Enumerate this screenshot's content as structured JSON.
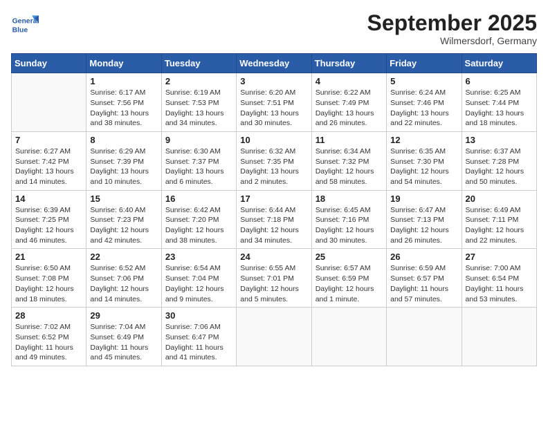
{
  "header": {
    "logo_text_general": "General",
    "logo_text_blue": "Blue",
    "month": "September 2025",
    "location": "Wilmersdorf, Germany"
  },
  "days_of_week": [
    "Sunday",
    "Monday",
    "Tuesday",
    "Wednesday",
    "Thursday",
    "Friday",
    "Saturday"
  ],
  "weeks": [
    [
      {
        "day": "",
        "sunrise": "",
        "sunset": "",
        "daylight": ""
      },
      {
        "day": "1",
        "sunrise": "Sunrise: 6:17 AM",
        "sunset": "Sunset: 7:56 PM",
        "daylight": "Daylight: 13 hours and 38 minutes."
      },
      {
        "day": "2",
        "sunrise": "Sunrise: 6:19 AM",
        "sunset": "Sunset: 7:53 PM",
        "daylight": "Daylight: 13 hours and 34 minutes."
      },
      {
        "day": "3",
        "sunrise": "Sunrise: 6:20 AM",
        "sunset": "Sunset: 7:51 PM",
        "daylight": "Daylight: 13 hours and 30 minutes."
      },
      {
        "day": "4",
        "sunrise": "Sunrise: 6:22 AM",
        "sunset": "Sunset: 7:49 PM",
        "daylight": "Daylight: 13 hours and 26 minutes."
      },
      {
        "day": "5",
        "sunrise": "Sunrise: 6:24 AM",
        "sunset": "Sunset: 7:46 PM",
        "daylight": "Daylight: 13 hours and 22 minutes."
      },
      {
        "day": "6",
        "sunrise": "Sunrise: 6:25 AM",
        "sunset": "Sunset: 7:44 PM",
        "daylight": "Daylight: 13 hours and 18 minutes."
      }
    ],
    [
      {
        "day": "7",
        "sunrise": "Sunrise: 6:27 AM",
        "sunset": "Sunset: 7:42 PM",
        "daylight": "Daylight: 13 hours and 14 minutes."
      },
      {
        "day": "8",
        "sunrise": "Sunrise: 6:29 AM",
        "sunset": "Sunset: 7:39 PM",
        "daylight": "Daylight: 13 hours and 10 minutes."
      },
      {
        "day": "9",
        "sunrise": "Sunrise: 6:30 AM",
        "sunset": "Sunset: 7:37 PM",
        "daylight": "Daylight: 13 hours and 6 minutes."
      },
      {
        "day": "10",
        "sunrise": "Sunrise: 6:32 AM",
        "sunset": "Sunset: 7:35 PM",
        "daylight": "Daylight: 13 hours and 2 minutes."
      },
      {
        "day": "11",
        "sunrise": "Sunrise: 6:34 AM",
        "sunset": "Sunset: 7:32 PM",
        "daylight": "Daylight: 12 hours and 58 minutes."
      },
      {
        "day": "12",
        "sunrise": "Sunrise: 6:35 AM",
        "sunset": "Sunset: 7:30 PM",
        "daylight": "Daylight: 12 hours and 54 minutes."
      },
      {
        "day": "13",
        "sunrise": "Sunrise: 6:37 AM",
        "sunset": "Sunset: 7:28 PM",
        "daylight": "Daylight: 12 hours and 50 minutes."
      }
    ],
    [
      {
        "day": "14",
        "sunrise": "Sunrise: 6:39 AM",
        "sunset": "Sunset: 7:25 PM",
        "daylight": "Daylight: 12 hours and 46 minutes."
      },
      {
        "day": "15",
        "sunrise": "Sunrise: 6:40 AM",
        "sunset": "Sunset: 7:23 PM",
        "daylight": "Daylight: 12 hours and 42 minutes."
      },
      {
        "day": "16",
        "sunrise": "Sunrise: 6:42 AM",
        "sunset": "Sunset: 7:20 PM",
        "daylight": "Daylight: 12 hours and 38 minutes."
      },
      {
        "day": "17",
        "sunrise": "Sunrise: 6:44 AM",
        "sunset": "Sunset: 7:18 PM",
        "daylight": "Daylight: 12 hours and 34 minutes."
      },
      {
        "day": "18",
        "sunrise": "Sunrise: 6:45 AM",
        "sunset": "Sunset: 7:16 PM",
        "daylight": "Daylight: 12 hours and 30 minutes."
      },
      {
        "day": "19",
        "sunrise": "Sunrise: 6:47 AM",
        "sunset": "Sunset: 7:13 PM",
        "daylight": "Daylight: 12 hours and 26 minutes."
      },
      {
        "day": "20",
        "sunrise": "Sunrise: 6:49 AM",
        "sunset": "Sunset: 7:11 PM",
        "daylight": "Daylight: 12 hours and 22 minutes."
      }
    ],
    [
      {
        "day": "21",
        "sunrise": "Sunrise: 6:50 AM",
        "sunset": "Sunset: 7:08 PM",
        "daylight": "Daylight: 12 hours and 18 minutes."
      },
      {
        "day": "22",
        "sunrise": "Sunrise: 6:52 AM",
        "sunset": "Sunset: 7:06 PM",
        "daylight": "Daylight: 12 hours and 14 minutes."
      },
      {
        "day": "23",
        "sunrise": "Sunrise: 6:54 AM",
        "sunset": "Sunset: 7:04 PM",
        "daylight": "Daylight: 12 hours and 9 minutes."
      },
      {
        "day": "24",
        "sunrise": "Sunrise: 6:55 AM",
        "sunset": "Sunset: 7:01 PM",
        "daylight": "Daylight: 12 hours and 5 minutes."
      },
      {
        "day": "25",
        "sunrise": "Sunrise: 6:57 AM",
        "sunset": "Sunset: 6:59 PM",
        "daylight": "Daylight: 12 hours and 1 minute."
      },
      {
        "day": "26",
        "sunrise": "Sunrise: 6:59 AM",
        "sunset": "Sunset: 6:57 PM",
        "daylight": "Daylight: 11 hours and 57 minutes."
      },
      {
        "day": "27",
        "sunrise": "Sunrise: 7:00 AM",
        "sunset": "Sunset: 6:54 PM",
        "daylight": "Daylight: 11 hours and 53 minutes."
      }
    ],
    [
      {
        "day": "28",
        "sunrise": "Sunrise: 7:02 AM",
        "sunset": "Sunset: 6:52 PM",
        "daylight": "Daylight: 11 hours and 49 minutes."
      },
      {
        "day": "29",
        "sunrise": "Sunrise: 7:04 AM",
        "sunset": "Sunset: 6:49 PM",
        "daylight": "Daylight: 11 hours and 45 minutes."
      },
      {
        "day": "30",
        "sunrise": "Sunrise: 7:06 AM",
        "sunset": "Sunset: 6:47 PM",
        "daylight": "Daylight: 11 hours and 41 minutes."
      },
      {
        "day": "",
        "sunrise": "",
        "sunset": "",
        "daylight": ""
      },
      {
        "day": "",
        "sunrise": "",
        "sunset": "",
        "daylight": ""
      },
      {
        "day": "",
        "sunrise": "",
        "sunset": "",
        "daylight": ""
      },
      {
        "day": "",
        "sunrise": "",
        "sunset": "",
        "daylight": ""
      }
    ]
  ]
}
